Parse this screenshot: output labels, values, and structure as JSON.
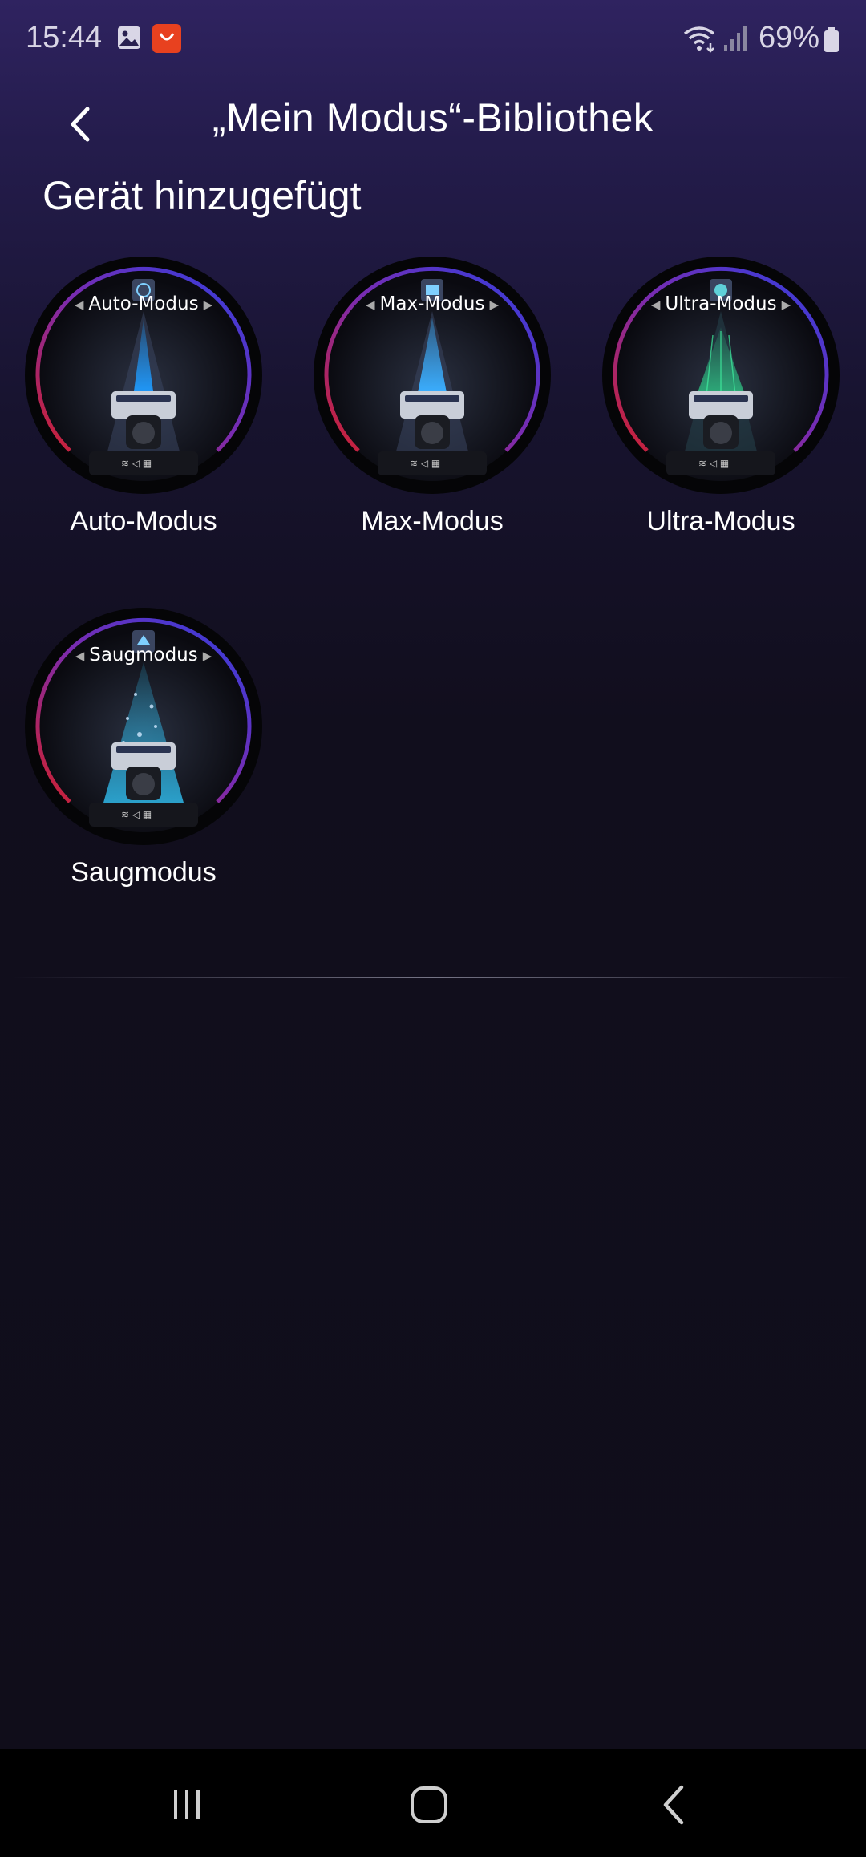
{
  "status_bar": {
    "time": "15:44",
    "battery": "69%",
    "icons": [
      "gallery-icon",
      "aliexpress-icon",
      "wifi-icon",
      "signal-icon",
      "battery-icon"
    ]
  },
  "header": {
    "title": "„Mein Modus“-Bibliothek",
    "back_icon": "chevron-left-icon"
  },
  "section": {
    "title": "Gerät hinzugefügt"
  },
  "modes": [
    {
      "dial_label": "Auto-Modus",
      "label": "Auto-Modus",
      "beam_color": "#1e9bff"
    },
    {
      "dial_label": "Max-Modus",
      "label": "Max-Modus",
      "beam_color": "#3aaeff"
    },
    {
      "dial_label": "Ultra-Modus",
      "label": "Ultra-Modus",
      "beam_color": "#2fd08a"
    },
    {
      "dial_label": "Saugmodus",
      "label": "Saugmodus",
      "beam_color": "#2fb8e8"
    }
  ],
  "colors": {
    "ring_start": "#d0202e",
    "ring_mid": "#7a2bb0",
    "ring_end": "#2f3fe0"
  },
  "nav_bar": {
    "icons": [
      "recent-apps-icon",
      "home-icon",
      "back-icon"
    ]
  }
}
